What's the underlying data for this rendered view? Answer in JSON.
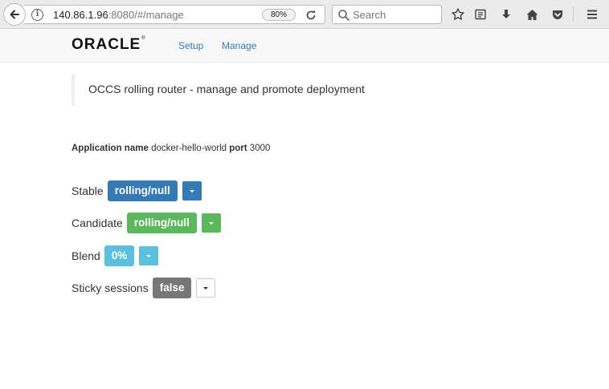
{
  "browser": {
    "url_host": "140.86.1.96",
    "url_rest": ":8080/#/manage",
    "zoom": "80%",
    "search_placeholder": "Search"
  },
  "nav": {
    "logo": "ORACLE",
    "logo_mark": "®",
    "links": [
      "Setup",
      "Manage"
    ]
  },
  "page": {
    "heading": "OCCS rolling router - manage and promote deployment",
    "app_name_label": "Application name",
    "app_name": "docker-hello-world",
    "port_label": "port",
    "port": "3000"
  },
  "controls": [
    {
      "label": "Stable",
      "value": "rolling/null",
      "color": "#337ab7"
    },
    {
      "label": "Candidate",
      "value": "rolling/null",
      "color": "#5cb85c"
    },
    {
      "label": "Blend",
      "value": "0%",
      "color": "#5bc0de"
    },
    {
      "label": "Sticky sessions",
      "value": "false",
      "color": "#777777"
    }
  ],
  "icons": [
    "back-icon",
    "info-icon",
    "reload-icon",
    "search-icon",
    "bookmark-star-icon",
    "reading-list-icon",
    "download-icon",
    "home-icon",
    "pocket-icon",
    "menu-icon"
  ]
}
